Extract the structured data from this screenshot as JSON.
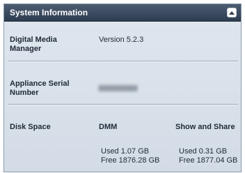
{
  "panel": {
    "title": "System Information",
    "collapse_icon": "chevron-up-icon"
  },
  "rows": {
    "dmm": {
      "label": "Digital Media Manager",
      "value": "Version 5.2.3"
    },
    "serial": {
      "label": "Appliance Serial Number",
      "value_obscured": true
    },
    "disk": {
      "label": "Disk Space",
      "col1_header": "DMM",
      "col2_header": "Show and Share",
      "dmm_used": "Used 1.07 GB",
      "dmm_free": "Free 1876.28 GB",
      "sns_used": "Used 0.31 GB",
      "sns_free": "Free 1877.04 GB"
    }
  },
  "colors": {
    "header_bg": "#3a4a5f",
    "panel_bg": "#d9e1ea",
    "text": "#1f2a36"
  }
}
